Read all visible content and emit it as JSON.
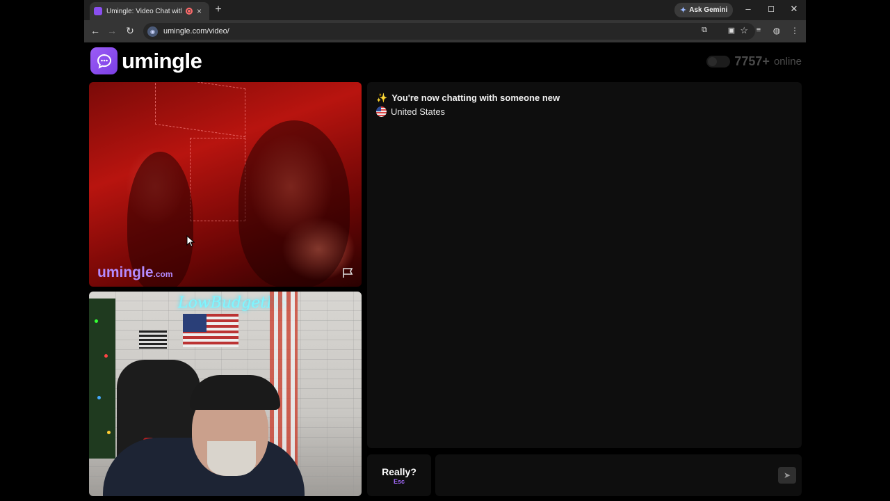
{
  "browser": {
    "tab_title": "Umingle: Video Chat with S",
    "tab_close": "×",
    "new_tab": "+",
    "gemini_label": "Ask Gemini",
    "window_controls": [
      "–",
      "☐",
      "✕"
    ],
    "url": "umingle.com/video/",
    "icons": {
      "back": "back-arrow-icon",
      "forward": "forward-arrow-icon",
      "reload": "reload-icon",
      "bookmark": "star-icon",
      "extensions": "puzzle-icon",
      "menu": "kebab-menu-icon"
    }
  },
  "site": {
    "logo_text": "umingle",
    "online_count": "7757+",
    "online_label": "online"
  },
  "video": {
    "watermark_main": "umingle",
    "watermark_suffix": ".com",
    "neon_sign": "LowBudgetRS"
  },
  "chat": {
    "sparkle": "✨",
    "message": "You're now chatting with someone new",
    "country": "United States"
  },
  "controls": {
    "action_label": "Really?",
    "action_key": "Esc",
    "send_icon": "➤"
  },
  "colors": {
    "brand_purple": "#8b4cf0",
    "page_bg": "#000000",
    "panel_bg": "#0e0e0e"
  }
}
